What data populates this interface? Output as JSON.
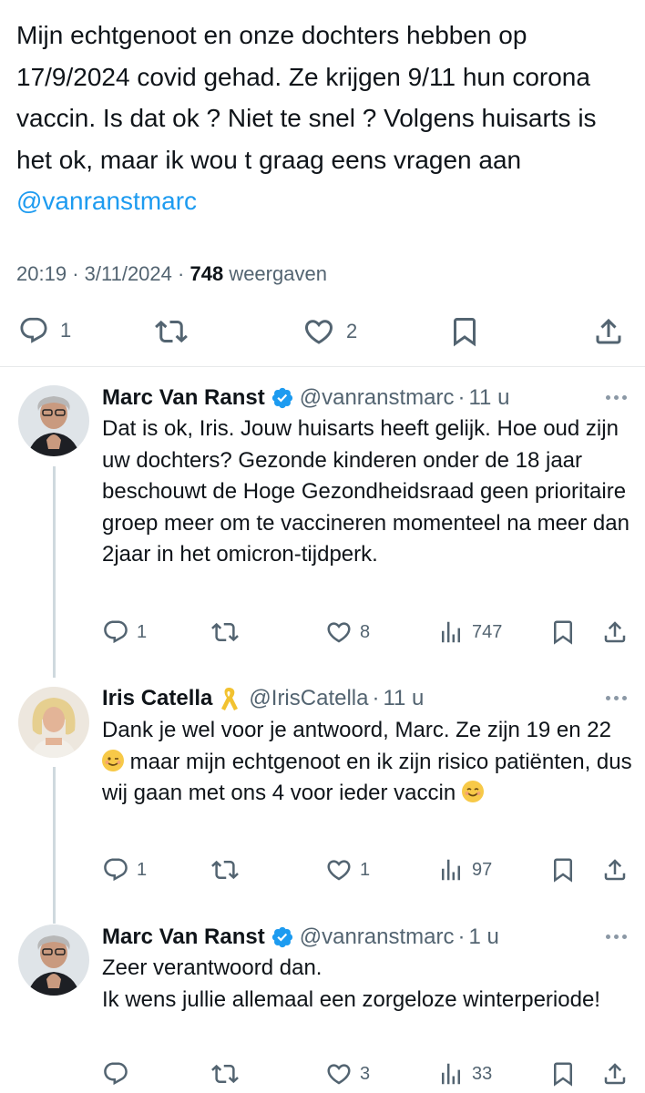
{
  "tweet": {
    "text_before": "Mijn echtgenoot en onze dochters hebben op 17/9/2024 covid gehad. Ze krijgen 9/11 hun corona vaccin. Is dat ok ? Niet te snel ? Volgens huisarts is het ok, maar ik wou t graag eens vragen aan ",
    "mention": "@vanranstmarc",
    "time": "20:19",
    "date": "3/11/2024",
    "views": "748",
    "views_label": "weergaven",
    "sep": "·",
    "replies": "1",
    "likes": "2"
  },
  "replies": [
    {
      "name": "Marc Van Ranst",
      "handle": "@vanranstmarc",
      "age": "11 u",
      "body": "Dat is ok, Iris. Jouw huisarts heeft gelijk. Hoe oud zijn uw dochters? Gezonde kinderen onder de 18 jaar beschouwt de Hoge Gezondheidsraad geen prioritaire groep meer om te vaccineren momenteel na meer dan 2jaar in het omicron-tijdperk.",
      "replies": "1",
      "reposts": "",
      "likes": "8",
      "views": "747"
    },
    {
      "name": "Iris Catella",
      "handle": "@IrisCatella",
      "age": "11 u",
      "body_1": "Dank je wel voor je antwoord, Marc.  Ze zijn 19 en 22 ",
      "body_2": " maar mijn echtgenoot en ik zijn risico patiënten, dus wij gaan met ons 4 voor ieder vaccin ",
      "replies": "1",
      "reposts": "",
      "likes": "1",
      "views": "97"
    },
    {
      "name": "Marc Van Ranst",
      "handle": "@vanranstmarc",
      "age": "1 u",
      "body_line1": "Zeer verantwoord dan.",
      "body_line2": "Ik wens jullie allemaal een zorgeloze winterperiode!",
      "replies": "",
      "reposts": "",
      "likes": "3",
      "views": "33"
    }
  ],
  "colors": {
    "text": "#0f1419",
    "secondary": "#536471",
    "link": "#1d9bf0",
    "verified": "#1d9bf0",
    "divider": "#e7e9ea"
  },
  "icons": [
    "reply-icon",
    "repost-icon",
    "like-icon",
    "bookmark-icon",
    "share-icon",
    "views-icon",
    "verified-badge-icon",
    "ribbon-icon",
    "more-icon"
  ]
}
